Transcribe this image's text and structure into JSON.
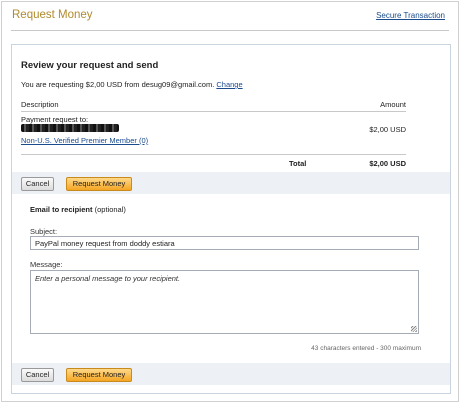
{
  "header": {
    "title": "Request Money",
    "secure_link": "Secure Transaction"
  },
  "review": {
    "heading": "Review your request and send",
    "requesting_text": "You are requesting $2,00 USD from desug09@gmail.com.",
    "change_link": "Change"
  },
  "table": {
    "col_description": "Description",
    "col_amount": "Amount",
    "payment_to_label": "Payment request to:",
    "member_link": "Non-U.S. Verified Premier Member (0)",
    "row_amount": "$2,00 USD",
    "total_label": "Total",
    "total_amount": "$2,00 USD"
  },
  "buttons": {
    "cancel": "Cancel",
    "request": "Request Money"
  },
  "email": {
    "heading": "Email to recipient",
    "optional": "(optional)",
    "subject_label": "Subject:",
    "subject_value": "PayPal money request from doddy estiara",
    "message_label": "Message:",
    "message_placeholder": "Enter a personal message to your recipient.",
    "char_count": "43 characters entered - 300 maximum"
  }
}
